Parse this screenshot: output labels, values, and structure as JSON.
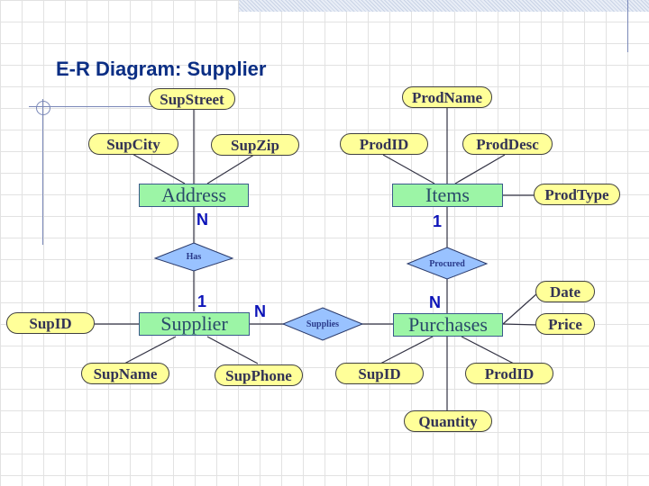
{
  "title": "E-R Diagram: Supplier",
  "colors": {
    "title": "#0b2e84",
    "attribute_fill": "#ffff99",
    "entity_fill": "#9cf5a6",
    "relationship_fill": "#99c2ff",
    "cardinality": "#0c13b8"
  },
  "entities": {
    "address": "Address",
    "items": "Items",
    "supplier": "Supplier",
    "purchases": "Purchases"
  },
  "relationships": {
    "has": "Has",
    "procured": "Procured",
    "supplies": "Supplies"
  },
  "attributes": {
    "sup_street": "SupStreet",
    "sup_city": "SupCity",
    "sup_zip": "SupZip",
    "prod_name": "ProdName",
    "prod_id": "ProdID",
    "prod_desc": "ProdDesc",
    "prod_type": "ProdType",
    "sup_id": "SupID",
    "sup_name": "SupName",
    "sup_phone": "SupPhone",
    "purch_sup_id": "SupID",
    "purch_prod_id": "ProdID",
    "quantity": "Quantity",
    "date": "Date",
    "price": "Price"
  },
  "cardinalities": {
    "address_has": "N",
    "items_procured": "1",
    "supplier_has": "1",
    "supplier_supplies": "N",
    "purchases_procured": "N"
  }
}
